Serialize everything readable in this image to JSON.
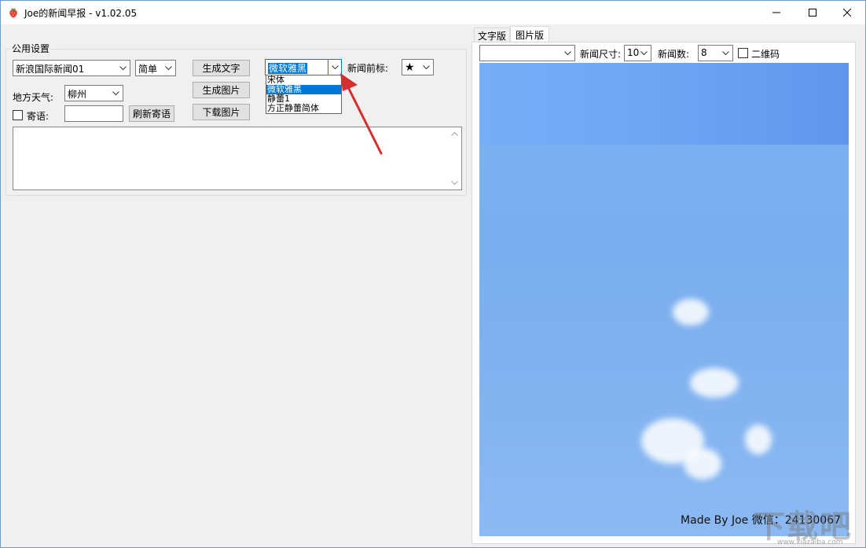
{
  "window": {
    "title": "Joe的新闻早报 - v1.02.05"
  },
  "settings": {
    "group_title": "公用设置",
    "news_source": "新浪国际新闻01",
    "language": "简单",
    "generate_text_btn": "生成文字",
    "generate_image_btn": "生成图片",
    "download_image_btn": "下载图片",
    "font_combo_value": "微软雅黑",
    "font_options": [
      "宋体",
      "微软雅黑",
      "静蕾1",
      "方正静蕾简体"
    ],
    "news_prefix_label": "新闻前标:",
    "news_prefix_value": "★",
    "weather_label": "地方天气:",
    "weather_city": "柳州",
    "message_label": "寄语:",
    "message_value": "",
    "refresh_message_btn": "刷新寄语"
  },
  "tabs": [
    {
      "label": "文字版",
      "active": false
    },
    {
      "label": "图片版",
      "active": true
    }
  ],
  "image_tab": {
    "style_combo_value": "",
    "news_size_label": "新闻尺寸:",
    "news_size_value": "10",
    "news_count_label": "新闻数:",
    "news_count_value": "8",
    "qrcode_label": "二维码",
    "footer_text": "Made By Joe 微信：24130067"
  },
  "watermark": {
    "big_text": "下载吧",
    "small_text": "www.xiazaiba.com"
  },
  "colors": {
    "accent": "#0078d7",
    "arrow": "#d32f2f",
    "sky": "#7eb1f2"
  },
  "icons": {
    "app": "strawberry-icon",
    "minimize": "minimize-icon",
    "maximize": "maximize-icon",
    "close": "close-icon",
    "chevron": "chevron-down-icon"
  }
}
